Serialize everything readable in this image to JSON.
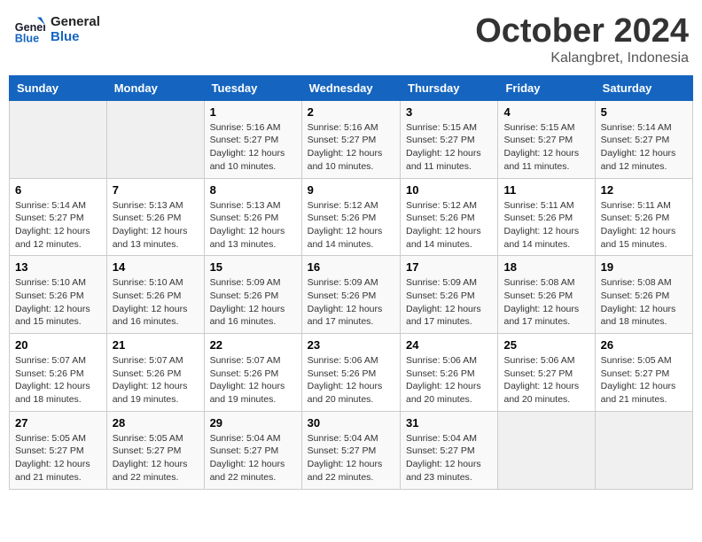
{
  "header": {
    "logo_line1": "General",
    "logo_line2": "Blue",
    "month": "October 2024",
    "location": "Kalangbret, Indonesia"
  },
  "weekdays": [
    "Sunday",
    "Monday",
    "Tuesday",
    "Wednesday",
    "Thursday",
    "Friday",
    "Saturday"
  ],
  "weeks": [
    [
      {
        "day": "",
        "info": ""
      },
      {
        "day": "",
        "info": ""
      },
      {
        "day": "1",
        "info": "Sunrise: 5:16 AM\nSunset: 5:27 PM\nDaylight: 12 hours\nand 10 minutes."
      },
      {
        "day": "2",
        "info": "Sunrise: 5:16 AM\nSunset: 5:27 PM\nDaylight: 12 hours\nand 10 minutes."
      },
      {
        "day": "3",
        "info": "Sunrise: 5:15 AM\nSunset: 5:27 PM\nDaylight: 12 hours\nand 11 minutes."
      },
      {
        "day": "4",
        "info": "Sunrise: 5:15 AM\nSunset: 5:27 PM\nDaylight: 12 hours\nand 11 minutes."
      },
      {
        "day": "5",
        "info": "Sunrise: 5:14 AM\nSunset: 5:27 PM\nDaylight: 12 hours\nand 12 minutes."
      }
    ],
    [
      {
        "day": "6",
        "info": "Sunrise: 5:14 AM\nSunset: 5:27 PM\nDaylight: 12 hours\nand 12 minutes."
      },
      {
        "day": "7",
        "info": "Sunrise: 5:13 AM\nSunset: 5:26 PM\nDaylight: 12 hours\nand 13 minutes."
      },
      {
        "day": "8",
        "info": "Sunrise: 5:13 AM\nSunset: 5:26 PM\nDaylight: 12 hours\nand 13 minutes."
      },
      {
        "day": "9",
        "info": "Sunrise: 5:12 AM\nSunset: 5:26 PM\nDaylight: 12 hours\nand 14 minutes."
      },
      {
        "day": "10",
        "info": "Sunrise: 5:12 AM\nSunset: 5:26 PM\nDaylight: 12 hours\nand 14 minutes."
      },
      {
        "day": "11",
        "info": "Sunrise: 5:11 AM\nSunset: 5:26 PM\nDaylight: 12 hours\nand 14 minutes."
      },
      {
        "day": "12",
        "info": "Sunrise: 5:11 AM\nSunset: 5:26 PM\nDaylight: 12 hours\nand 15 minutes."
      }
    ],
    [
      {
        "day": "13",
        "info": "Sunrise: 5:10 AM\nSunset: 5:26 PM\nDaylight: 12 hours\nand 15 minutes."
      },
      {
        "day": "14",
        "info": "Sunrise: 5:10 AM\nSunset: 5:26 PM\nDaylight: 12 hours\nand 16 minutes."
      },
      {
        "day": "15",
        "info": "Sunrise: 5:09 AM\nSunset: 5:26 PM\nDaylight: 12 hours\nand 16 minutes."
      },
      {
        "day": "16",
        "info": "Sunrise: 5:09 AM\nSunset: 5:26 PM\nDaylight: 12 hours\nand 17 minutes."
      },
      {
        "day": "17",
        "info": "Sunrise: 5:09 AM\nSunset: 5:26 PM\nDaylight: 12 hours\nand 17 minutes."
      },
      {
        "day": "18",
        "info": "Sunrise: 5:08 AM\nSunset: 5:26 PM\nDaylight: 12 hours\nand 17 minutes."
      },
      {
        "day": "19",
        "info": "Sunrise: 5:08 AM\nSunset: 5:26 PM\nDaylight: 12 hours\nand 18 minutes."
      }
    ],
    [
      {
        "day": "20",
        "info": "Sunrise: 5:07 AM\nSunset: 5:26 PM\nDaylight: 12 hours\nand 18 minutes."
      },
      {
        "day": "21",
        "info": "Sunrise: 5:07 AM\nSunset: 5:26 PM\nDaylight: 12 hours\nand 19 minutes."
      },
      {
        "day": "22",
        "info": "Sunrise: 5:07 AM\nSunset: 5:26 PM\nDaylight: 12 hours\nand 19 minutes."
      },
      {
        "day": "23",
        "info": "Sunrise: 5:06 AM\nSunset: 5:26 PM\nDaylight: 12 hours\nand 20 minutes."
      },
      {
        "day": "24",
        "info": "Sunrise: 5:06 AM\nSunset: 5:26 PM\nDaylight: 12 hours\nand 20 minutes."
      },
      {
        "day": "25",
        "info": "Sunrise: 5:06 AM\nSunset: 5:27 PM\nDaylight: 12 hours\nand 20 minutes."
      },
      {
        "day": "26",
        "info": "Sunrise: 5:05 AM\nSunset: 5:27 PM\nDaylight: 12 hours\nand 21 minutes."
      }
    ],
    [
      {
        "day": "27",
        "info": "Sunrise: 5:05 AM\nSunset: 5:27 PM\nDaylight: 12 hours\nand 21 minutes."
      },
      {
        "day": "28",
        "info": "Sunrise: 5:05 AM\nSunset: 5:27 PM\nDaylight: 12 hours\nand 22 minutes."
      },
      {
        "day": "29",
        "info": "Sunrise: 5:04 AM\nSunset: 5:27 PM\nDaylight: 12 hours\nand 22 minutes."
      },
      {
        "day": "30",
        "info": "Sunrise: 5:04 AM\nSunset: 5:27 PM\nDaylight: 12 hours\nand 22 minutes."
      },
      {
        "day": "31",
        "info": "Sunrise: 5:04 AM\nSunset: 5:27 PM\nDaylight: 12 hours\nand 23 minutes."
      },
      {
        "day": "",
        "info": ""
      },
      {
        "day": "",
        "info": ""
      }
    ]
  ]
}
